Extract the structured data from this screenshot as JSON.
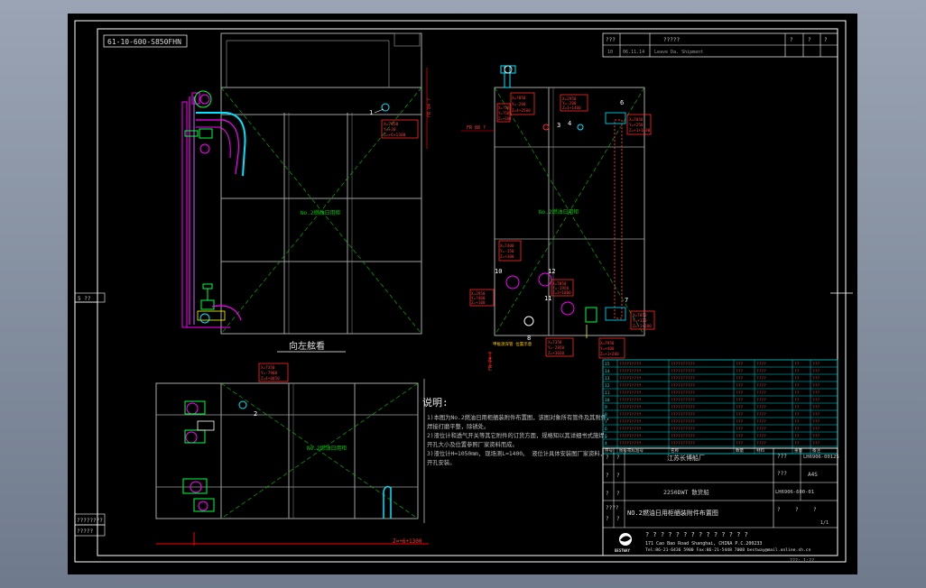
{
  "drawing_number_stamp": "61-10-600-S850FHN",
  "revision_block": {
    "row1": [
      "???",
      "?????",
      "?",
      "?",
      "?"
    ],
    "row2": [
      "10",
      "06.11.14",
      "Leave Da. Shipment"
    ]
  },
  "side_labels": {
    "left_tab_top": "5 ??",
    "left_tab_bottom1": "????????",
    "left_tab_bottom2": "?????"
  },
  "views": {
    "main_view_label": "向左舷看",
    "tank_label_left": "No.2燃油日用柜",
    "tank_label_right": "No.2燃油日用柜",
    "tank_label_plan": "No.2燃油日用柜"
  },
  "notes": {
    "title": "说明:",
    "lines": [
      "1)本图为No.2燃油日用柜舾装附件布置图，该图对象所有管件及其附件，",
      "  焊接打磨平整，除锈处。",
      "2)液位计和透气开关等其它附件的订货方面，规格知以其详细书式施焊，",
      "  开孔大小及位置参照厂家资料而成。",
      "3)液位计H=1050mm, 现场测L=1400。  液位计具体安装图厂家资料，",
      "  开孔安装。"
    ]
  },
  "callouts": {
    "c1": [
      "X=7050",
      "Y=+30",
      "Z=+6+1300"
    ],
    "c2": [
      "X=?850",
      "Y=-200",
      "Z=4+2500"
    ],
    "c3": [
      "X=?50",
      "Y=?50",
      "Z=+100"
    ],
    "c4": [
      "X=2950",
      "Y=-200",
      "Z=1+1400"
    ],
    "c5": [
      "X=7050",
      "Y=+250",
      "Z=+1+1400"
    ],
    "c6": [
      "X=7400",
      "Y=-150",
      "Z=+100"
    ],
    "c7": [
      "X=2950",
      "Y=?400",
      "Z=+100"
    ],
    "c8": [
      "X=7050",
      "Y=-1950",
      "Z=3+1000"
    ],
    "c9": [
      "X=7350",
      "Y=-2850",
      "Z=+3030"
    ],
    "c10": [
      "X=7950",
      "Y=+400",
      "Z=+1+200"
    ],
    "c11": [
      "X=7050",
      "Y=+120",
      "Z=+1+200"
    ],
    "c12": [
      "X=7350",
      "Y=-7900",
      "Z=4+0050"
    ],
    "c13": [
      "X=7350",
      "Y=-170",
      "Z=+6+1300"
    ]
  },
  "markers": [
    "1",
    "2",
    "3",
    "4",
    "5",
    "6",
    "7",
    "8",
    "9",
    "10",
    "11",
    "12"
  ],
  "fr_labels": [
    "FR 84 ?",
    "FR 88 ?",
    "FR 74 ?"
  ],
  "sounding_label": "甲板测深管 位置示意",
  "title_block": {
    "company": "江苏长博船厂",
    "drawing_no": "LH6906-0012S",
    "sheet": "A4S",
    "ship_type": "2250DWT 散货船",
    "drawing_title": "NO.2燃油日用柜舾装附件布置图",
    "drawing_code": "LH6906-600-01",
    "scale_label": "?",
    "sheet_no": "1/1",
    "misc": [
      "?",
      "?",
      "????",
      "???",
      "?",
      "?",
      "?",
      "?"
    ],
    "stars": "? ? ? ? ? ? ? ? ? ? ? ? ? ?",
    "address": "171 Cao Bao Road Shanghai, CHINA    P.C.200233",
    "contacts": "Tel:86-21-6436 5900   Fax:86-21-5448 7008   bestway@mail.online.sh.cn",
    "logo_text": "BESTWAY",
    "footer": "???: 1:??"
  },
  "bom": {
    "rows": [
      [
        "15",
        "?????????",
        "??????????",
        "???",
        "????",
        "??",
        "???"
      ],
      [
        "14",
        "?????????",
        "??????????",
        "???",
        "????",
        "??",
        "???"
      ],
      [
        "13",
        "?????????",
        "??????????",
        "???",
        "????",
        "??",
        "???"
      ],
      [
        "12",
        "?????????",
        "??????????",
        "???",
        "????",
        "??",
        "???"
      ],
      [
        "11",
        "?????????",
        "??????????",
        "???",
        "????",
        "??",
        "???"
      ],
      [
        "10",
        "?????????",
        "??????????",
        "???",
        "????",
        "??",
        "???"
      ],
      [
        "9",
        "?????????",
        "??????????",
        "???",
        "????",
        "??",
        "???"
      ],
      [
        "8",
        "?????????",
        "??????????",
        "???",
        "????",
        "??",
        "???"
      ],
      [
        "7",
        "?????????",
        "??????????",
        "???",
        "????",
        "??",
        "???"
      ],
      [
        "6",
        "?????????",
        "??????????",
        "???",
        "????",
        "??",
        "???"
      ],
      [
        "5",
        "?????????",
        "??????????",
        "???",
        "????",
        "??",
        "???"
      ],
      [
        "4",
        "?????????",
        "??????????",
        "???",
        "????",
        "??",
        "???"
      ]
    ],
    "header": [
      "序号",
      "图号或标准号",
      "名称",
      "数量",
      "材料",
      "重量",
      "备注"
    ]
  },
  "colors": {
    "screen_bg": "#000000",
    "line_white": "#ffffff",
    "line_gray": "#9a9a9a",
    "diag_green": "#00c800",
    "callout_red": "#ff2a2a",
    "pipe_magenta": "#ff00ff",
    "pipe_cyan": "#00e5ff",
    "valve_green": "#20ff20",
    "bom_cyan": "#00d5d5",
    "dim_red": "#ff0000",
    "text_gray": "#b8b8b8"
  }
}
